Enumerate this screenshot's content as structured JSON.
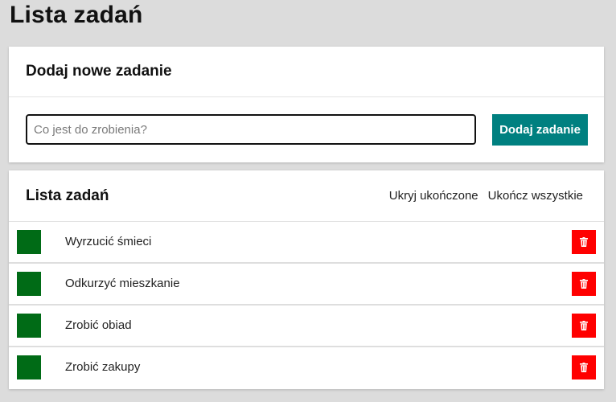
{
  "page": {
    "title": "Lista zadań"
  },
  "add_card": {
    "heading": "Dodaj nowe zadanie",
    "input_value": "",
    "input_placeholder": "Co jest do zrobienia?",
    "button_label": "Dodaj zadanie"
  },
  "list_card": {
    "heading": "Lista zadań",
    "hide_completed_label": "Ukryj ukończone",
    "complete_all_label": "Ukończ wszystkie",
    "tasks": [
      {
        "label": "Wyrzucić śmieci"
      },
      {
        "label": "Odkurzyć mieszkanie"
      },
      {
        "label": "Zrobić obiad"
      },
      {
        "label": "Zrobić zakupy"
      }
    ]
  },
  "colors": {
    "background": "#dcdcdc",
    "accent_button": "#008080",
    "complete_box": "#006b16",
    "delete_button": "#ff0000"
  },
  "icons": {
    "delete": "trash-icon"
  }
}
